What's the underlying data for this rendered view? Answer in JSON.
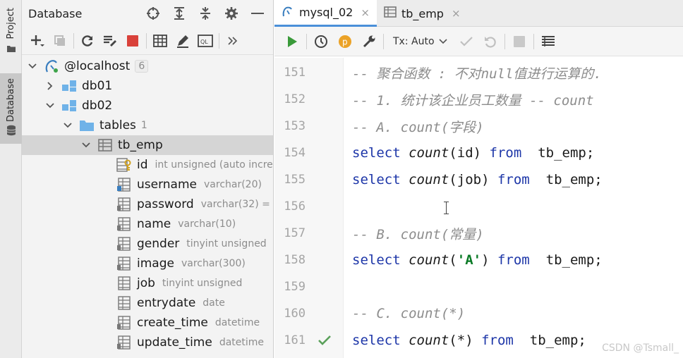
{
  "sidebar_tabs": {
    "project": "Project",
    "database": "Database"
  },
  "db_panel": {
    "title": "Database",
    "tree": {
      "root": {
        "label": "@localhost",
        "count": "6"
      },
      "db01": {
        "label": "db01"
      },
      "db02": {
        "label": "db02"
      },
      "tables": {
        "label": "tables",
        "count": "1"
      },
      "table": {
        "label": "tb_emp"
      },
      "columns": [
        {
          "name": "id",
          "type": "int unsigned (auto incre"
        },
        {
          "name": "username",
          "type": "varchar(20)"
        },
        {
          "name": "password",
          "type": "varchar(32) ="
        },
        {
          "name": "name",
          "type": "varchar(10)"
        },
        {
          "name": "gender",
          "type": "tinyint unsigned"
        },
        {
          "name": "image",
          "type": "varchar(300)"
        },
        {
          "name": "job",
          "type": "tinyint unsigned"
        },
        {
          "name": "entrydate",
          "type": "date"
        },
        {
          "name": "create_time",
          "type": "datetime"
        },
        {
          "name": "update_time",
          "type": "datetime"
        }
      ]
    }
  },
  "editor": {
    "tabs": [
      {
        "label": "mysql_02",
        "close": "×"
      },
      {
        "label": "tb_emp",
        "close": "×"
      }
    ],
    "tx_mode": "Tx: Auto",
    "lines": {
      "l151": {
        "no": "151",
        "text": "-- 聚合函数 : 不对null值进行运算的."
      },
      "l152": {
        "no": "152",
        "text": "-- 1. 统计该企业员工数量 -- count"
      },
      "l153": {
        "no": "153",
        "text": "-- A. count(字段)"
      },
      "l154": {
        "no": "154",
        "kw1": "select",
        "fn": "count",
        "open": "(",
        "arg": "id",
        "close": ")",
        "kw2": "from",
        "table": "tb_emp;"
      },
      "l155": {
        "no": "155",
        "kw1": "select",
        "fn": "count",
        "open": "(",
        "arg": "job",
        "close": ")",
        "kw2": "from",
        "table": "tb_emp;"
      },
      "l156": {
        "no": "156"
      },
      "l157": {
        "no": "157",
        "text": "-- B. count(常量)"
      },
      "l158": {
        "no": "158",
        "kw1": "select",
        "fn": "count",
        "open": "(",
        "arg": "'A'",
        "close": ")",
        "kw2": "from",
        "table": "tb_emp;"
      },
      "l159": {
        "no": "159"
      },
      "l160": {
        "no": "160",
        "text": "-- C. count(*)"
      },
      "l161": {
        "no": "161",
        "kw1": "select",
        "fn": "count",
        "open": "(",
        "arg": "*",
        "close": ")",
        "kw2": "from",
        "table": "tb_emp;"
      }
    }
  },
  "watermark": "CSDN @Tsmall_",
  "colors": {
    "keyword": "#1d36a8",
    "comment": "#8c8c8c",
    "string": "#0a7a26",
    "run": "#3a9a3a",
    "stop": "#d9413a",
    "folder": "#6fb2e8",
    "check": "#5aa05a"
  }
}
